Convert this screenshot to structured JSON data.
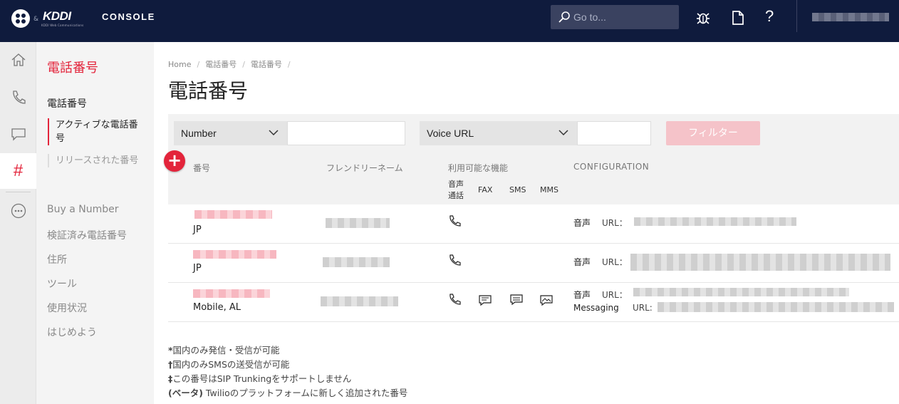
{
  "topbar": {
    "logo_alt": "Twilio",
    "ampersand": "&",
    "kddi": "KDDI",
    "kddi_sub": "KDDI Web Communications",
    "console_label": "CONSOLE",
    "search_placeholder": "Go to...",
    "icons": [
      "search-icon",
      "bug-icon",
      "document-icon",
      "help-icon"
    ],
    "help_label": "?"
  },
  "rail": {
    "items": [
      "home-icon",
      "phone-icon",
      "chat-icon",
      "hash-icon",
      "more-icon"
    ],
    "hash_glyph": "#"
  },
  "subnav": {
    "title": "電話番号",
    "section": "電話番号",
    "children": [
      {
        "label": "アクティブな電話番号",
        "active": true
      },
      {
        "label": "リリースされた番号",
        "active": false
      }
    ],
    "links": [
      "Buy a Number",
      "検証済み電話番号",
      "住所",
      "ツール",
      "使用状況",
      "はじめよう"
    ]
  },
  "main": {
    "breadcrumbs": [
      "Home",
      "電話番号",
      "電話番号"
    ],
    "title": "電話番号",
    "filters": {
      "select1": "Number",
      "select2": "Voice URL",
      "input1_value": "",
      "input2_value": "",
      "button": "フィルター"
    },
    "table": {
      "add_glyph": "+",
      "headers": {
        "number": "番号",
        "friendly_name": "フレンドリーネーム",
        "capabilities": "利用可能な機能",
        "configuration": "CONFIGURATION"
      },
      "capability_cols": [
        "音声\n通話",
        "FAX",
        "SMS",
        "MMS"
      ],
      "rows": [
        {
          "region": "JP",
          "features": [
            "voice"
          ],
          "config": [
            {
              "label": "音声",
              "url_label": "URL："
            }
          ]
        },
        {
          "region": "JP",
          "features": [
            "voice"
          ],
          "config": [
            {
              "label": "音声",
              "url_label": "URL："
            }
          ]
        },
        {
          "region": "Mobile, AL",
          "features": [
            "voice",
            "fax",
            "sms",
            "mms"
          ],
          "config": [
            {
              "label": "音声",
              "url_label": "URL："
            },
            {
              "label": "Messaging",
              "url_label": "URL:"
            }
          ]
        }
      ]
    },
    "footnotes": [
      {
        "mark": "*",
        "text": "国内のみ発信・受信が可能"
      },
      {
        "mark": "†",
        "text": "国内のみSMSの送受信が可能"
      },
      {
        "mark": "‡",
        "text": "この番号はSIP Trunkingをサポートしません"
      },
      {
        "mark": "(ベータ)",
        "text": " Twilioのプラットフォームに新しく追加された番号"
      }
    ]
  },
  "colors": {
    "accent": "#e3243b",
    "topbar": "#0f1b3d",
    "filter_button": "#f5c3c9"
  }
}
